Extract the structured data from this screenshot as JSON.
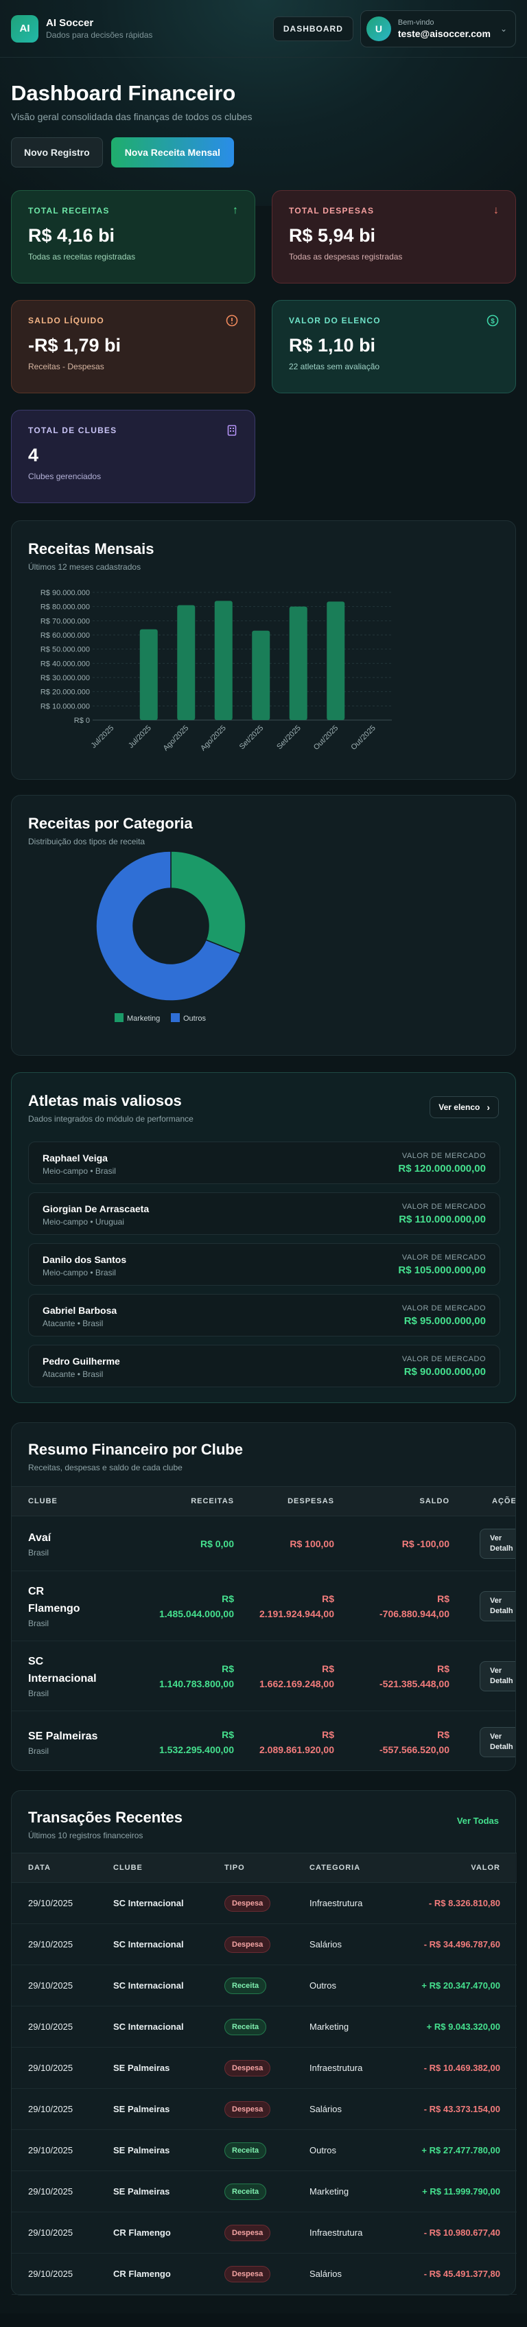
{
  "header": {
    "logo_text": "AI",
    "brand_name": "AI Soccer",
    "brand_tagline": "Dados para decisões rápidas",
    "dashboard_button": "DASHBOARD",
    "user_avatar": "U",
    "user_greeting": "Bem-vindo",
    "user_email": "teste@aisoccer.com",
    "chevron_icon": "chevron-down"
  },
  "page": {
    "title": "Dashboard Financeiro",
    "subtitle": "Visão geral consolidada das finanças de todos os clubes",
    "btn_new_record": "Novo Registro",
    "btn_new_revenue": "Nova Receita Mensal"
  },
  "kpis": [
    {
      "label": "TOTAL RECEITAS",
      "value": "R$ 4,16 bi",
      "desc": "Todas as receitas registradas",
      "icon": "arrow-up-icon",
      "color": "#45e08e"
    },
    {
      "label": "TOTAL DESPESAS",
      "value": "R$ 5,94 bi",
      "desc": "Todas as despesas registradas",
      "icon": "arrow-down-icon",
      "color": "#f27a6c"
    },
    {
      "label": "SALDO LÍQUIDO",
      "value": "-R$ 1,79 bi",
      "desc": "Receitas - Despesas",
      "icon": "alert-circle-icon",
      "color": "#f08a5d"
    },
    {
      "label": "VALOR DO ELENCO",
      "value": "R$ 1,10 bi",
      "desc": "22 atletas sem avaliação",
      "icon": "dollar-circle-icon",
      "color": "#3fd6a9"
    },
    {
      "label": "TOTAL DE CLUBES",
      "value": "4",
      "desc": "Clubes gerenciados",
      "icon": "building-icon",
      "color": "#b493f5"
    }
  ],
  "monthly_chart": {
    "title": "Receitas Mensais",
    "subtitle": "Últimos 12 meses cadastrados",
    "chart_data": {
      "type": "bar",
      "categories": [
        "Jul/2025",
        "Jul/2025",
        "Ago/2025",
        "Ago/2025",
        "Set/2025",
        "Set/2025",
        "Out/2025",
        "Out/2025"
      ],
      "values": [
        0,
        64000000,
        81000000,
        84000000,
        63000000,
        80000000,
        83500000,
        0
      ],
      "ylim": [
        0,
        90000000
      ],
      "yticks": [
        "R$ 0",
        "R$ 10.000.000",
        "R$ 20.000.000",
        "R$ 30.000.000",
        "R$ 40.000.000",
        "R$ 50.000.000",
        "R$ 60.000.000",
        "R$ 70.000.000",
        "R$ 80.000.000",
        "R$ 90.000.000"
      ],
      "color": "#1a7e58",
      "grid": true
    }
  },
  "category_chart": {
    "title": "Receitas por Categoria",
    "subtitle": "Distribuição dos tipos de receita",
    "chart_data": {
      "type": "pie",
      "categories": [
        "Marketing",
        "Outros"
      ],
      "values": [
        31,
        69
      ],
      "colors": [
        "#1b9a68",
        "#2f6fd6"
      ],
      "legend": "bottom"
    }
  },
  "athletes": {
    "title": "Atletas mais valiosos",
    "subtitle": "Dados integrados do módulo de performance",
    "button": "Ver elenco",
    "value_label": "VALOR DE MERCADO",
    "items": [
      {
        "name": "Raphael Veiga",
        "position": "Meio-campo • Brasil",
        "value": "R$ 120.000.000,00"
      },
      {
        "name": "Giorgian De Arrascaeta",
        "position": "Meio-campo • Uruguai",
        "value": "R$ 110.000.000,00"
      },
      {
        "name": "Danilo dos Santos",
        "position": "Meio-campo • Brasil",
        "value": "R$ 105.000.000,00"
      },
      {
        "name": "Gabriel Barbosa",
        "position": "Atacante • Brasil",
        "value": "R$ 95.000.000,00"
      },
      {
        "name": "Pedro Guilherme",
        "position": "Atacante • Brasil",
        "value": "R$ 90.000.000,00"
      }
    ]
  },
  "club_summary": {
    "title": "Resumo Financeiro por Clube",
    "subtitle": "Receitas, despesas e saldo de cada clube",
    "headers": [
      "CLUBE",
      "RECEITAS",
      "DESPESAS",
      "SALDO",
      "AÇÕE"
    ],
    "action_label_1": "Ver",
    "action_label_2": "Detalh",
    "rows": [
      {
        "club": [
          "Avaí"
        ],
        "country": "Brasil",
        "receitas": [
          "R$ 0,00"
        ],
        "despesas": [
          "R$ 100,00"
        ],
        "saldo": [
          "R$ -100,00"
        ]
      },
      {
        "club": [
          "CR",
          "Flamengo"
        ],
        "country": "Brasil",
        "receitas": [
          "R$",
          "1.485.044.000,00"
        ],
        "despesas": [
          "R$",
          "2.191.924.944,00"
        ],
        "saldo": [
          "R$",
          "-706.880.944,00"
        ]
      },
      {
        "club": [
          "SC",
          "Internacional"
        ],
        "country": "Brasil",
        "receitas": [
          "R$",
          "1.140.783.800,00"
        ],
        "despesas": [
          "R$",
          "1.662.169.248,00"
        ],
        "saldo": [
          "R$",
          "-521.385.448,00"
        ]
      },
      {
        "club": [
          "SE Palmeiras"
        ],
        "country": "Brasil",
        "receitas": [
          "R$",
          "1.532.295.400,00"
        ],
        "despesas": [
          "R$",
          "2.089.861.920,00"
        ],
        "saldo": [
          "R$",
          "-557.566.520,00"
        ]
      }
    ]
  },
  "transactions": {
    "title": "Transações Recentes",
    "subtitle": "Últimos 10 registros financeiros",
    "view_all": "Ver Todas",
    "headers": [
      "DATA",
      "CLUBE",
      "TIPO",
      "CATEGORIA",
      "VALOR"
    ],
    "rows": [
      {
        "date": "29/10/2025",
        "club": "SC Internacional",
        "type": "Despesa",
        "category": "Infraestrutura",
        "value": "- R$ 8.326.810,80"
      },
      {
        "date": "29/10/2025",
        "club": "SC Internacional",
        "type": "Despesa",
        "category": "Salários",
        "value": "- R$ 34.496.787,60"
      },
      {
        "date": "29/10/2025",
        "club": "SC Internacional",
        "type": "Receita",
        "category": "Outros",
        "value": "+ R$ 20.347.470,00"
      },
      {
        "date": "29/10/2025",
        "club": "SC Internacional",
        "type": "Receita",
        "category": "Marketing",
        "value": "+ R$ 9.043.320,00"
      },
      {
        "date": "29/10/2025",
        "club": "SE Palmeiras",
        "type": "Despesa",
        "category": "Infraestrutura",
        "value": "- R$ 10.469.382,00"
      },
      {
        "date": "29/10/2025",
        "club": "SE Palmeiras",
        "type": "Despesa",
        "category": "Salários",
        "value": "- R$ 43.373.154,00"
      },
      {
        "date": "29/10/2025",
        "club": "SE Palmeiras",
        "type": "Receita",
        "category": "Outros",
        "value": "+ R$ 27.477.780,00"
      },
      {
        "date": "29/10/2025",
        "club": "SE Palmeiras",
        "type": "Receita",
        "category": "Marketing",
        "value": "+ R$ 11.999.790,00"
      },
      {
        "date": "29/10/2025",
        "club": "CR Flamengo",
        "type": "Despesa",
        "category": "Infraestrutura",
        "value": "- R$ 10.980.677,40"
      },
      {
        "date": "29/10/2025",
        "club": "CR Flamengo",
        "type": "Despesa",
        "category": "Salários",
        "value": "- R$ 45.491.377,80"
      }
    ]
  }
}
